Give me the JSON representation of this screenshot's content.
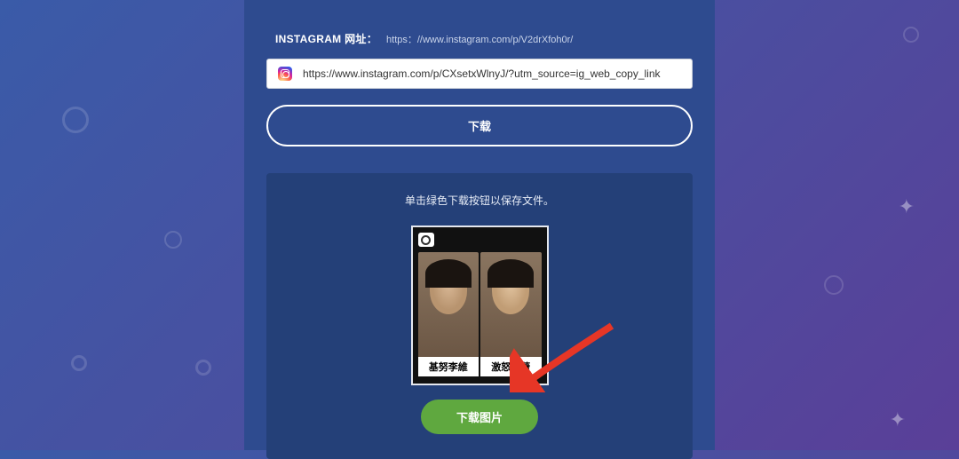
{
  "form": {
    "label_prefix": "INSTAGRAM 网址：",
    "label_example": "https：//www.instagram.com/p/V2drXfoh0r/",
    "url_value": "https://www.instagram.com/p/CXsetxWlnyJ/?utm_source=ig_web_copy_link",
    "download_label": "下载"
  },
  "result": {
    "hint": "单击绿色下载按钮以保存文件。",
    "caption_left": "基努李維",
    "caption_right": "激怒李蕾",
    "save_label": "下载图片"
  }
}
